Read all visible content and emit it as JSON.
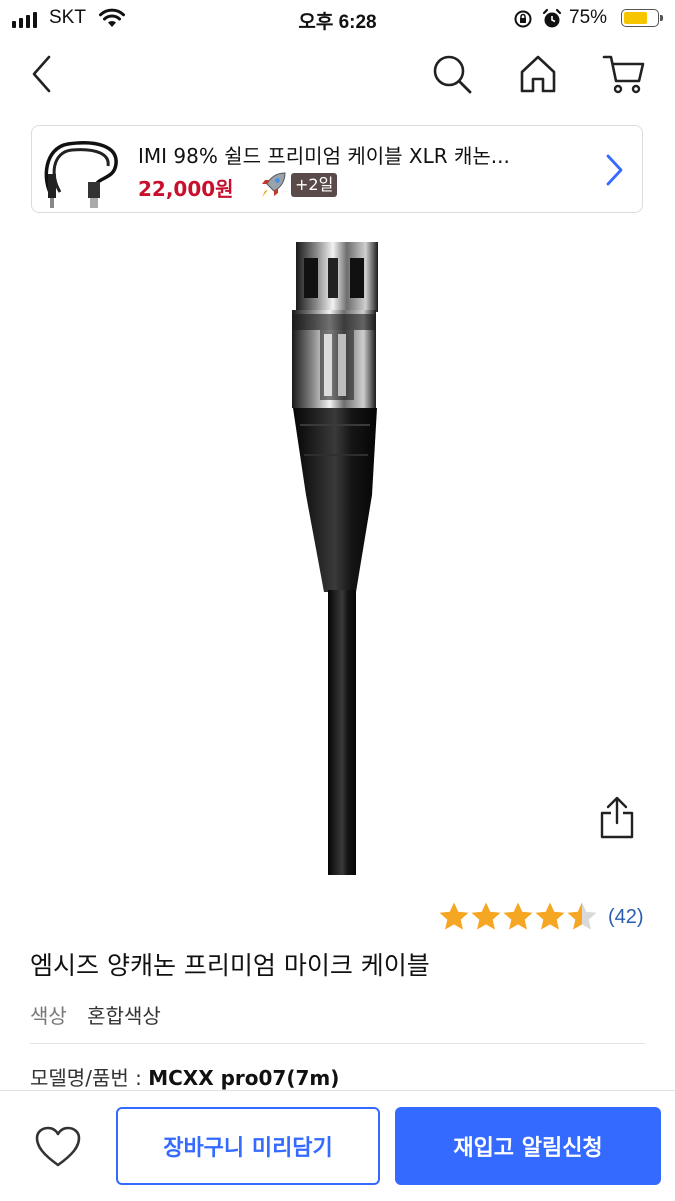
{
  "status_bar": {
    "carrier": "SKT",
    "time": "오후 6:28",
    "battery_percent": "75%",
    "battery_level": 0.75,
    "icons": [
      "signal-icon",
      "wifi-icon",
      "orientation-lock-icon",
      "alarm-icon",
      "battery-icon"
    ]
  },
  "nav": {
    "icons": [
      "back-arrow-icon",
      "search-icon",
      "home-icon",
      "cart-icon"
    ]
  },
  "mini_product": {
    "title": "IMI 98% 쉴드 프리미엄 케이블 XLR 캐논...",
    "price": "22,000원",
    "delivery_badge": "+2일",
    "icons": [
      "rocket-icon",
      "chevron-right-icon"
    ]
  },
  "product": {
    "rating_value": 4.5,
    "rating_max": 5,
    "review_count": "(42)",
    "title": "엠시즈 양캐논 프리미엄 마이크 케이블",
    "option_label": "색상",
    "option_value": "혼합색상",
    "model_label": "모델명/품번 : ",
    "model_value": "MCXX pro07(7m)"
  },
  "bottom_bar": {
    "cart_label": "장바구니 미리담기",
    "notify_label": "재입고 알림신청",
    "icons": [
      "heart-icon"
    ]
  },
  "colors": {
    "accent": "#346aff",
    "price": "#c8102e",
    "star": "#f5a623",
    "review_count": "#2a5db0"
  }
}
